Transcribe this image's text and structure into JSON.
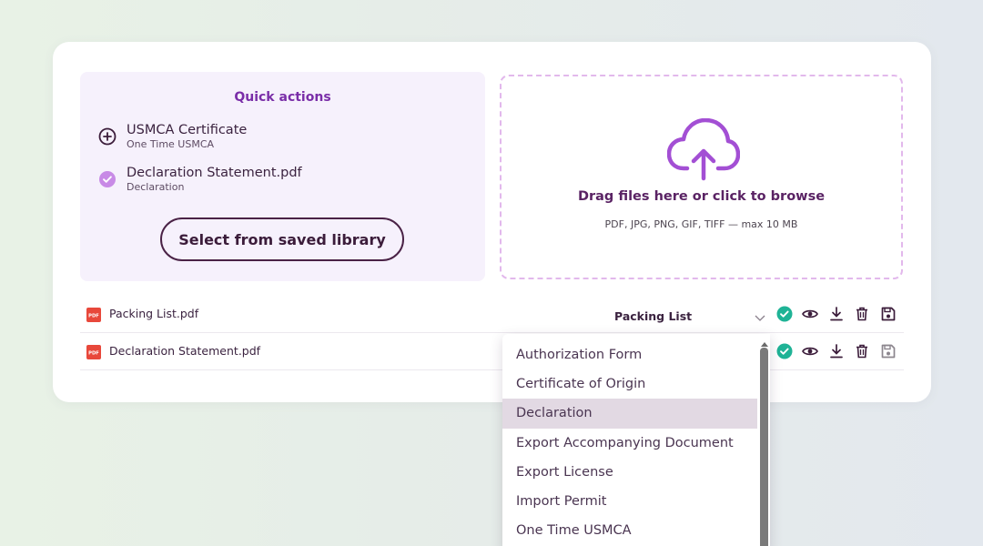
{
  "quick_actions": {
    "title": "Quick actions",
    "items": [
      {
        "name": "USMCA Certificate",
        "sub": "One Time USMCA",
        "icon": "plus-circle-icon"
      },
      {
        "name": "Declaration Statement.pdf",
        "sub": "Declaration",
        "icon": "check-circle-icon"
      }
    ],
    "library_button": "Select from saved library"
  },
  "dropzone": {
    "title": "Drag files here or click to browse",
    "subtitle": "PDF, JPG, PNG, GIF, TIFF — max 10 MB",
    "icon": "cloud-upload-icon"
  },
  "files": [
    {
      "name": "Packing List.pdf",
      "doc_type": "Packing List",
      "icon_label": "PDF"
    },
    {
      "name": "Declaration Statement.pdf",
      "doc_type": "",
      "icon_label": "PDF"
    }
  ],
  "dropdown": {
    "options": [
      "Authorization Form",
      "Certificate of Origin",
      "Declaration",
      "Export Accompanying Document",
      "Export License",
      "Import Permit",
      "One Time USMCA"
    ],
    "highlighted": "Declaration"
  },
  "colors": {
    "accent": "#7a2ea8",
    "check": "#1fb396",
    "pdf_red": "#e8483b",
    "button_border": "#4a2246"
  }
}
